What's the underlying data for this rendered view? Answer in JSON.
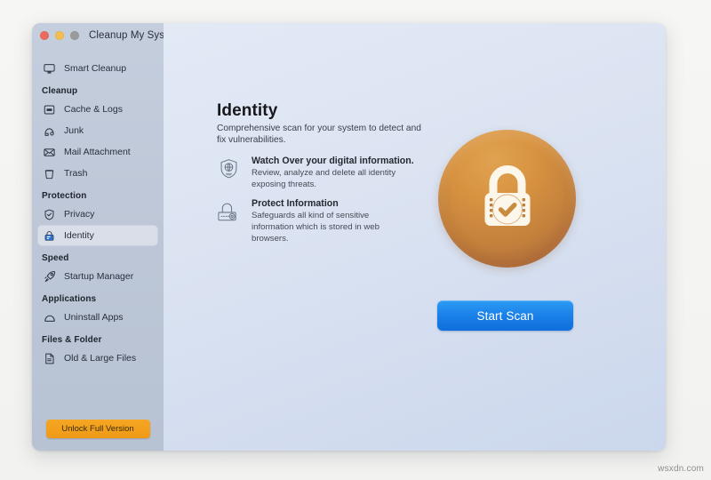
{
  "window": {
    "app_title": "Cleanup My System",
    "traffic_lights": [
      {
        "name": "close",
        "color": "#ec6a5f"
      },
      {
        "name": "minimize",
        "color": "#f4be4f"
      },
      {
        "name": "zoom",
        "color": "#9b9b9b"
      }
    ]
  },
  "sidebar": {
    "top_item": {
      "label": "Smart Cleanup",
      "icon": "monitor-icon"
    },
    "groups": [
      {
        "title": "Cleanup",
        "items": [
          {
            "label": "Cache & Logs",
            "icon": "logs-icon",
            "selected": false
          },
          {
            "label": "Junk",
            "icon": "junk-icon",
            "selected": false
          },
          {
            "label": "Mail Attachment",
            "icon": "mail-icon",
            "selected": false
          },
          {
            "label": "Trash",
            "icon": "trash-icon",
            "selected": false
          }
        ]
      },
      {
        "title": "Protection",
        "items": [
          {
            "label": "Privacy",
            "icon": "shield-check-icon",
            "selected": false
          },
          {
            "label": "Identity",
            "icon": "lock-icon",
            "selected": true
          }
        ]
      },
      {
        "title": "Speed",
        "items": [
          {
            "label": "Startup Manager",
            "icon": "rocket-icon",
            "selected": false
          }
        ]
      },
      {
        "title": "Applications",
        "items": [
          {
            "label": "Uninstall Apps",
            "icon": "app-arch-icon",
            "selected": false
          }
        ]
      },
      {
        "title": "Files & Folder",
        "items": [
          {
            "label": "Old & Large Files",
            "icon": "document-icon",
            "selected": false
          }
        ]
      }
    ],
    "unlock_button": "Unlock Full Version"
  },
  "main": {
    "heading": "Identity",
    "subheading": "Comprehensive scan for your system to detect and fix vulnerabilities.",
    "features": [
      {
        "icon": "shield-globe-icon",
        "title": "Watch Over your digital information.",
        "description": "Review, analyze and delete all identity exposing threats."
      },
      {
        "icon": "padlock-combination-icon",
        "title": "Protect Information",
        "description": "Safeguards all kind of sensitive information which is stored in web browsers."
      }
    ],
    "hero_icon": "orange-lock-check-badge",
    "scan_button": "Start Scan"
  },
  "watermark": "wsxdn.com",
  "colors": {
    "accent_blue": "#1a7fe8",
    "accent_orange": "#f5a623",
    "sidebar_bg": "#bcc6d6",
    "content_bg": "#dbe3f2",
    "hero_orange": "#d79240"
  }
}
